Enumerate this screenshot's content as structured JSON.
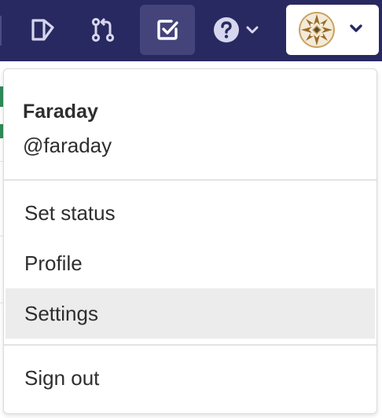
{
  "topbar": {
    "icons": [
      "todo-list-icon",
      "merge-request-icon",
      "issues-checkbox-icon",
      "help-icon",
      "chevron-down-icon"
    ],
    "background_color": "#292961",
    "active_item_color": "#44447a"
  },
  "user_menu": {
    "avatar_icon": "geometric-avatar-icon",
    "name": "Faraday",
    "username": "@faraday",
    "items": [
      {
        "label": "Set status"
      },
      {
        "label": "Profile"
      },
      {
        "label": "Settings",
        "highlighted": true
      },
      {
        "label": "Sign out"
      }
    ]
  }
}
